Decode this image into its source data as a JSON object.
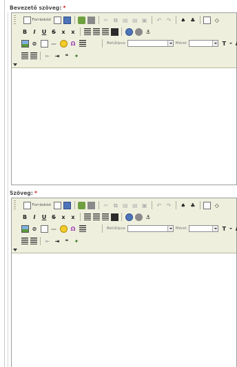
{
  "fields": [
    {
      "label": "Bevezető szöveg:",
      "required_mark": "*"
    },
    {
      "label": "Szöveg:",
      "required_mark": "*"
    }
  ],
  "toolbar": {
    "source_label": "Forráskód",
    "font_label": "Betűtípus",
    "font_value": "",
    "size_label": "Méret",
    "size_value": ""
  },
  "icons": {
    "row1": [
      "source-icon",
      "preview-icon",
      "templates-icon",
      "spellcheck-icon",
      "print-icon",
      "cut-icon",
      "copy-icon",
      "paste-icon",
      "paste-text-icon",
      "paste-word-icon",
      "undo-icon",
      "redo-icon",
      "find-icon",
      "replace-icon",
      "select-all-icon",
      "remove-format-icon"
    ],
    "row2": [
      "bold-icon",
      "italic-icon",
      "underline-icon",
      "strikethrough-icon",
      "subscript-icon",
      "superscript-icon",
      "align-left-icon",
      "align-center-icon",
      "align-right-icon",
      "align-justify-icon",
      "link-icon",
      "unlink-icon",
      "anchor-icon"
    ],
    "row3": [
      "image-icon",
      "flash-icon",
      "table-icon",
      "horizontal-rule-icon",
      "smiley-icon",
      "special-char-icon",
      "page-break-icon",
      "text-color-icon",
      "background-color-icon"
    ],
    "row4": [
      "numbered-list-icon",
      "bulleted-list-icon",
      "outdent-icon",
      "indent-icon",
      "blockquote-icon",
      "about-icon"
    ]
  },
  "colors": {
    "toolbar_bg": "#efefde",
    "border": "#9c9c9c",
    "required": "#d12020",
    "label": "#4a4a4a"
  }
}
